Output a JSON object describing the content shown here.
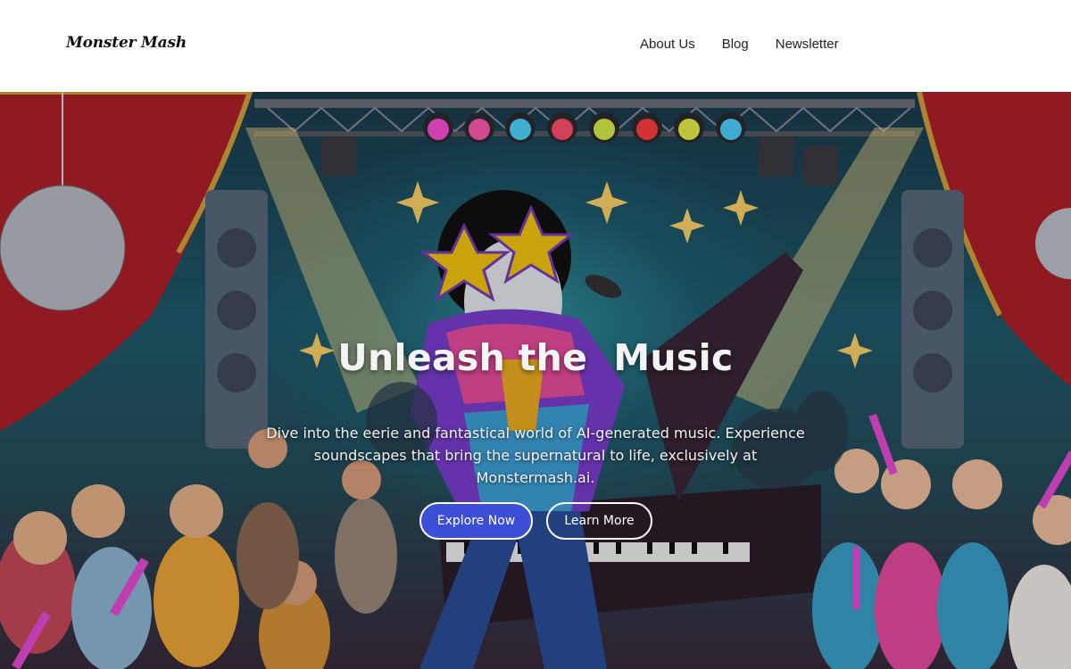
{
  "header": {
    "logo": "Monster Mash",
    "nav": [
      {
        "label": "About Us"
      },
      {
        "label": "Blog"
      },
      {
        "label": "Newsletter"
      }
    ]
  },
  "hero": {
    "title": "Unleash the  Music",
    "description": "Dive into the eerie and fantastical world of AI-generated music. Experience soundscapes that bring the supernatural to life, exclusively at Monstermash.ai.",
    "primary_button": "Explore Now",
    "secondary_button": "Learn More",
    "colors": {
      "primary_button_bg": "#3b4fd6",
      "title_text": "#f4f4f4",
      "curtain_red": "#b0202a"
    }
  }
}
